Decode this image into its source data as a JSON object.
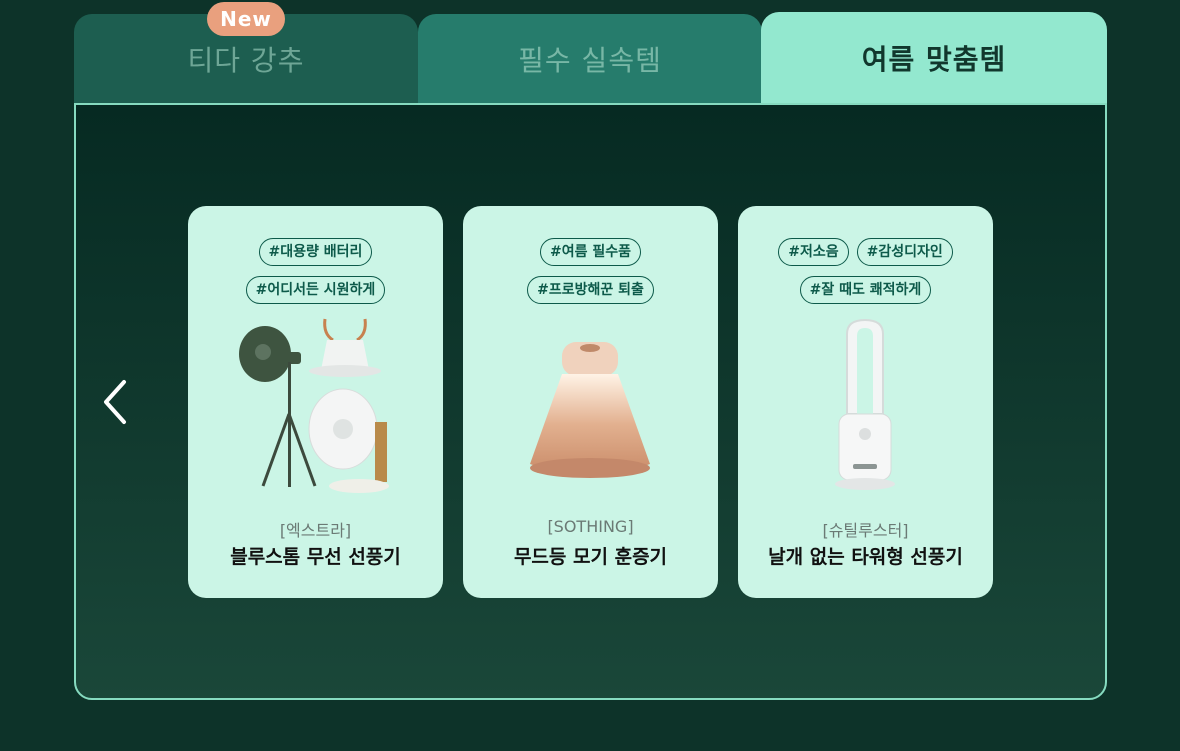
{
  "tabs": [
    {
      "label": "티다 강추",
      "badge": "New"
    },
    {
      "label": "필수 실속템"
    },
    {
      "label": "여름 맞춤템"
    }
  ],
  "colors": {
    "background": "#0d3329",
    "active_tab": "#93e8cf",
    "card": "#cbf5e6",
    "tag": "#0d5a4a",
    "badge": "#e9a07e"
  },
  "icons": {
    "prev": "chevron-left-icon"
  },
  "products": [
    {
      "tags_row1": [
        "#대용량 배터리"
      ],
      "tags_row2": [
        "#어디서든 시원하게"
      ],
      "brand": "[엑스트라]",
      "name": "블루스톰 무선 선풍기"
    },
    {
      "tags_row1": [
        "#여름 필수품"
      ],
      "tags_row2": [
        "#프로방해꾼 퇴출"
      ],
      "brand": "[SOTHING]",
      "name": "무드등 모기 훈증기"
    },
    {
      "tags_row1": [
        "#저소음",
        "#감성디자인"
      ],
      "tags_row2": [
        "#잘 때도 쾌적하게"
      ],
      "brand": "[슈틸루스터]",
      "name": "날개 없는 타워형 선풍기"
    }
  ]
}
